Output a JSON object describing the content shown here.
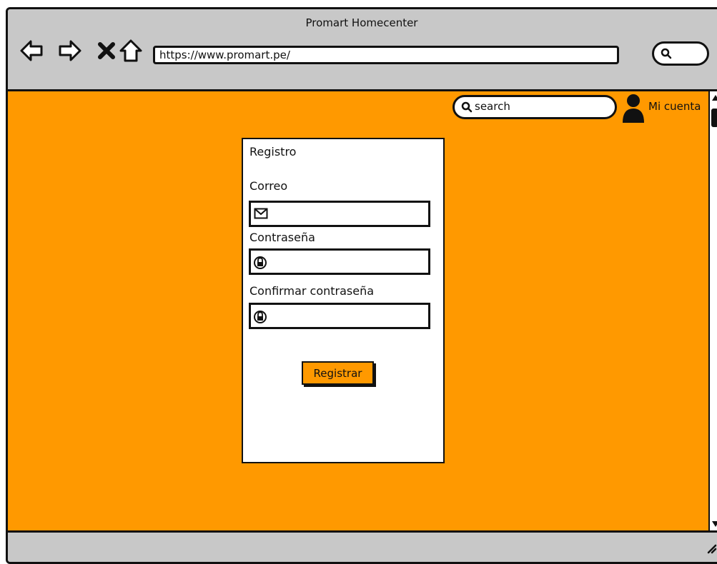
{
  "window": {
    "title": "Promart Homecenter"
  },
  "toolbar": {
    "back_icon": "arrow-left-icon",
    "forward_icon": "arrow-right-icon",
    "stop_icon": "close-icon",
    "home_icon": "home-icon",
    "url": "https://www.promart.pe/",
    "search_icon": "search-icon"
  },
  "header": {
    "search_placeholder": "search",
    "account_label": "Mi cuenta",
    "account_icon": "user-icon"
  },
  "form": {
    "heading": "Registro",
    "email_label": "Correo",
    "email_value": "",
    "email_icon": "envelope-icon",
    "password_label": "Contraseña",
    "password_value": "",
    "password_icon": "lock-icon",
    "confirm_label": "Confirmar contraseña",
    "confirm_value": "",
    "confirm_icon": "lock-icon",
    "submit_label": "Registrar"
  },
  "colors": {
    "page_background": "#ff9900",
    "chrome": "#c8c8c8",
    "button": "#ff9900"
  }
}
